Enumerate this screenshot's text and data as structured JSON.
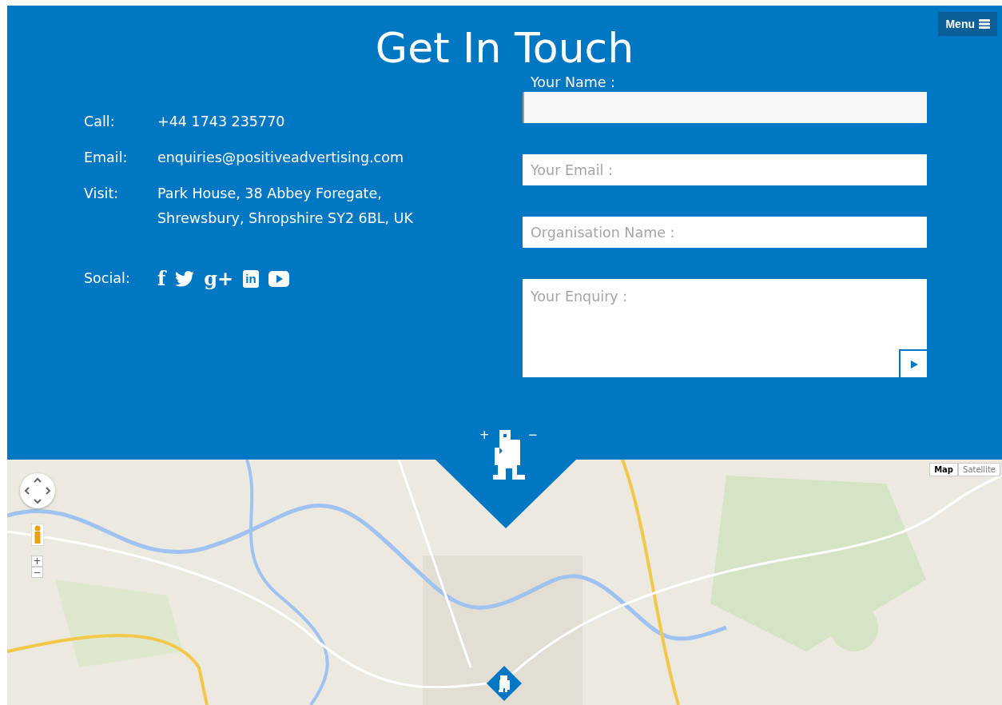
{
  "header": {
    "title": "Get In Touch",
    "menu_button": "Menu"
  },
  "contact": [
    {
      "label": "Call:",
      "lines": [
        "+44 1743 235770"
      ]
    },
    {
      "label": "Email:",
      "lines": [
        "enquiries@positiveadvertising.com"
      ]
    },
    {
      "label": "Visit:",
      "lines": [
        "Park House, 38 Abbey Foregate,",
        "Shrewsbury, Shropshire SY2 6BL, UK"
      ]
    }
  ],
  "social": {
    "label": "Social:",
    "icons": [
      {
        "kind": "glyph",
        "glyph": "f"
      },
      {
        "kind": "bird"
      },
      {
        "kind": "glyph",
        "glyph": "g+"
      },
      {
        "kind": "boxed",
        "glyph": "in"
      },
      {
        "kind": "play"
      }
    ]
  },
  "form": {
    "fields": [
      {
        "kind": "input",
        "label": "Your Name :",
        "focused": true
      },
      {
        "kind": "input",
        "placeholder": "Your Email :",
        "focused": false
      },
      {
        "kind": "input",
        "placeholder": "Organisation Name :",
        "focused": false
      },
      {
        "kind": "textarea",
        "placeholder": "Your Enquiry :",
        "focused": false
      }
    ]
  },
  "logo": {
    "plus": "+",
    "minus": "−"
  },
  "map": {
    "kind": "picture",
    "zoom_in": "+",
    "zoom_out": "−",
    "map_types": [
      {
        "label": "Map",
        "selected": true
      },
      {
        "label": "Satellite",
        "selected": false
      }
    ]
  }
}
